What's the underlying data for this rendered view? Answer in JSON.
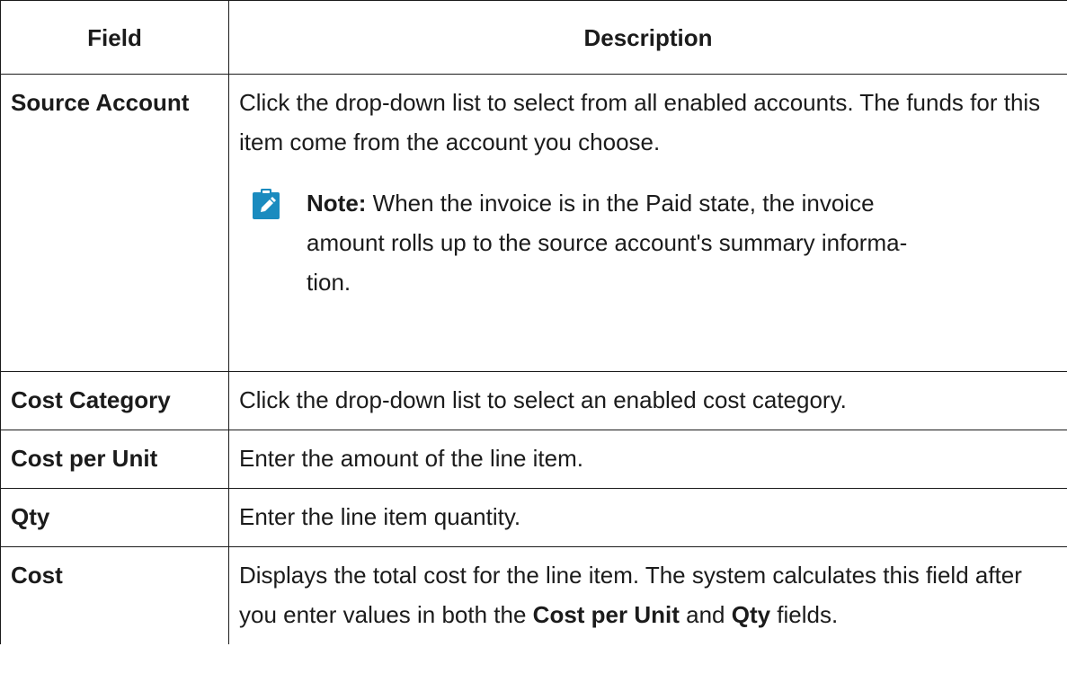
{
  "table": {
    "headers": [
      "Field",
      "Description"
    ],
    "rows": {
      "source_account": {
        "field": "Source Account",
        "description": "Click the drop-down list to select from all enabled accounts. The funds for this item come from the account you choose.",
        "note_label": "Note:",
        "note_line1": " When the invoice is in the Paid state, the invoice",
        "note_line2": "amount rolls up to the source account's summary informa-",
        "note_line3": "tion."
      },
      "cost_category": {
        "field": "Cost Category",
        "description": "Click the drop-down list to select an enabled cost category."
      },
      "cost_per_unit": {
        "field": "Cost per Unit",
        "description": "Enter the amount of the line item."
      },
      "qty": {
        "field": "Qty",
        "description": "Enter the line item quantity."
      },
      "cost": {
        "field": "Cost",
        "description_a": "Displays the total cost for the line item. The system calculates this field after you enter values in both the ",
        "bold_1": "Cost per Unit",
        "description_b": " and ",
        "bold_2": "Qty",
        "description_c": " fields."
      }
    }
  },
  "note_icon": "pencil-note-icon",
  "colors": {
    "note_icon_bg": "#1a8bbf",
    "text": "#1b1b1b",
    "border": "#1b1b1b"
  }
}
